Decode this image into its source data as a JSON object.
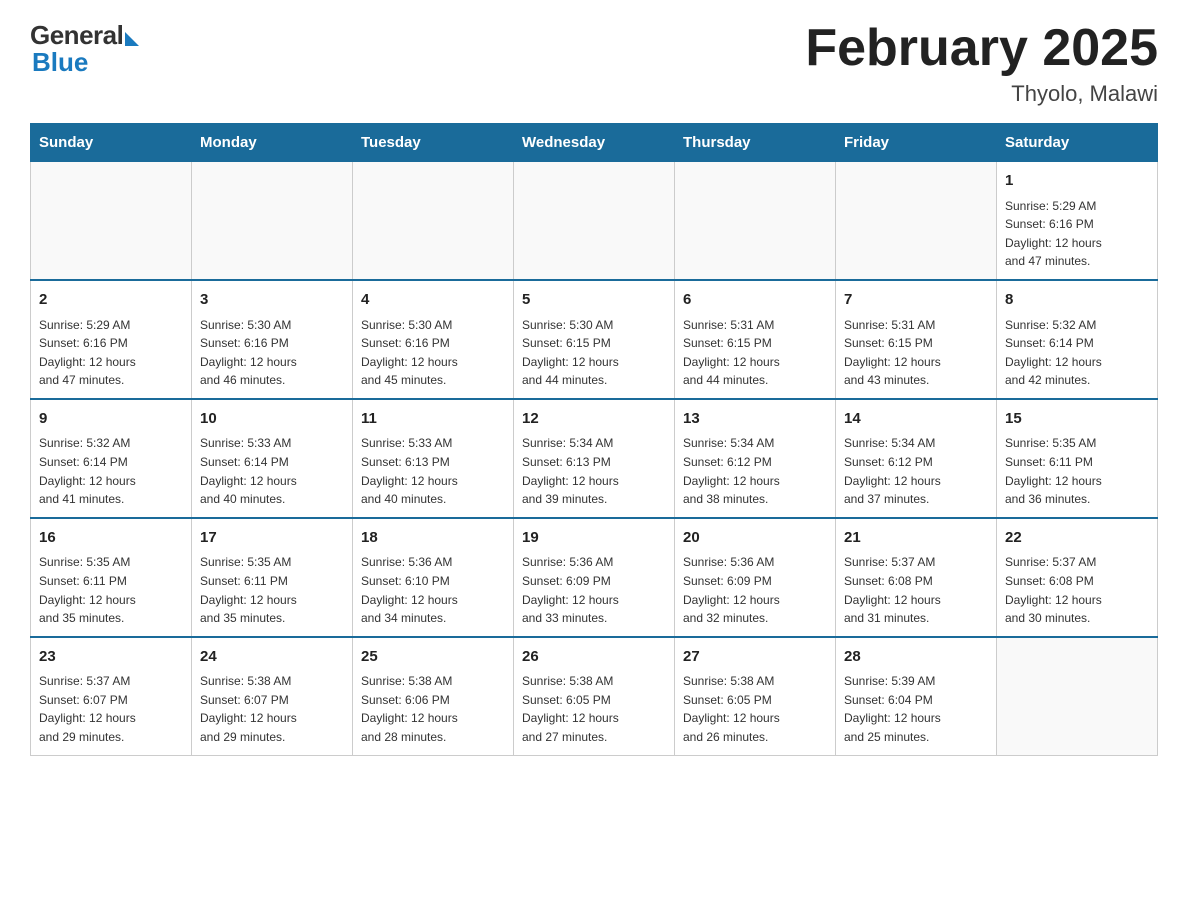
{
  "header": {
    "logo_general": "General",
    "logo_blue": "Blue",
    "month_title": "February 2025",
    "location": "Thyolo, Malawi"
  },
  "days_of_week": [
    "Sunday",
    "Monday",
    "Tuesday",
    "Wednesday",
    "Thursday",
    "Friday",
    "Saturday"
  ],
  "weeks": [
    [
      {
        "day": "",
        "info": ""
      },
      {
        "day": "",
        "info": ""
      },
      {
        "day": "",
        "info": ""
      },
      {
        "day": "",
        "info": ""
      },
      {
        "day": "",
        "info": ""
      },
      {
        "day": "",
        "info": ""
      },
      {
        "day": "1",
        "info": "Sunrise: 5:29 AM\nSunset: 6:16 PM\nDaylight: 12 hours\nand 47 minutes."
      }
    ],
    [
      {
        "day": "2",
        "info": "Sunrise: 5:29 AM\nSunset: 6:16 PM\nDaylight: 12 hours\nand 47 minutes."
      },
      {
        "day": "3",
        "info": "Sunrise: 5:30 AM\nSunset: 6:16 PM\nDaylight: 12 hours\nand 46 minutes."
      },
      {
        "day": "4",
        "info": "Sunrise: 5:30 AM\nSunset: 6:16 PM\nDaylight: 12 hours\nand 45 minutes."
      },
      {
        "day": "5",
        "info": "Sunrise: 5:30 AM\nSunset: 6:15 PM\nDaylight: 12 hours\nand 44 minutes."
      },
      {
        "day": "6",
        "info": "Sunrise: 5:31 AM\nSunset: 6:15 PM\nDaylight: 12 hours\nand 44 minutes."
      },
      {
        "day": "7",
        "info": "Sunrise: 5:31 AM\nSunset: 6:15 PM\nDaylight: 12 hours\nand 43 minutes."
      },
      {
        "day": "8",
        "info": "Sunrise: 5:32 AM\nSunset: 6:14 PM\nDaylight: 12 hours\nand 42 minutes."
      }
    ],
    [
      {
        "day": "9",
        "info": "Sunrise: 5:32 AM\nSunset: 6:14 PM\nDaylight: 12 hours\nand 41 minutes."
      },
      {
        "day": "10",
        "info": "Sunrise: 5:33 AM\nSunset: 6:14 PM\nDaylight: 12 hours\nand 40 minutes."
      },
      {
        "day": "11",
        "info": "Sunrise: 5:33 AM\nSunset: 6:13 PM\nDaylight: 12 hours\nand 40 minutes."
      },
      {
        "day": "12",
        "info": "Sunrise: 5:34 AM\nSunset: 6:13 PM\nDaylight: 12 hours\nand 39 minutes."
      },
      {
        "day": "13",
        "info": "Sunrise: 5:34 AM\nSunset: 6:12 PM\nDaylight: 12 hours\nand 38 minutes."
      },
      {
        "day": "14",
        "info": "Sunrise: 5:34 AM\nSunset: 6:12 PM\nDaylight: 12 hours\nand 37 minutes."
      },
      {
        "day": "15",
        "info": "Sunrise: 5:35 AM\nSunset: 6:11 PM\nDaylight: 12 hours\nand 36 minutes."
      }
    ],
    [
      {
        "day": "16",
        "info": "Sunrise: 5:35 AM\nSunset: 6:11 PM\nDaylight: 12 hours\nand 35 minutes."
      },
      {
        "day": "17",
        "info": "Sunrise: 5:35 AM\nSunset: 6:11 PM\nDaylight: 12 hours\nand 35 minutes."
      },
      {
        "day": "18",
        "info": "Sunrise: 5:36 AM\nSunset: 6:10 PM\nDaylight: 12 hours\nand 34 minutes."
      },
      {
        "day": "19",
        "info": "Sunrise: 5:36 AM\nSunset: 6:09 PM\nDaylight: 12 hours\nand 33 minutes."
      },
      {
        "day": "20",
        "info": "Sunrise: 5:36 AM\nSunset: 6:09 PM\nDaylight: 12 hours\nand 32 minutes."
      },
      {
        "day": "21",
        "info": "Sunrise: 5:37 AM\nSunset: 6:08 PM\nDaylight: 12 hours\nand 31 minutes."
      },
      {
        "day": "22",
        "info": "Sunrise: 5:37 AM\nSunset: 6:08 PM\nDaylight: 12 hours\nand 30 minutes."
      }
    ],
    [
      {
        "day": "23",
        "info": "Sunrise: 5:37 AM\nSunset: 6:07 PM\nDaylight: 12 hours\nand 29 minutes."
      },
      {
        "day": "24",
        "info": "Sunrise: 5:38 AM\nSunset: 6:07 PM\nDaylight: 12 hours\nand 29 minutes."
      },
      {
        "day": "25",
        "info": "Sunrise: 5:38 AM\nSunset: 6:06 PM\nDaylight: 12 hours\nand 28 minutes."
      },
      {
        "day": "26",
        "info": "Sunrise: 5:38 AM\nSunset: 6:05 PM\nDaylight: 12 hours\nand 27 minutes."
      },
      {
        "day": "27",
        "info": "Sunrise: 5:38 AM\nSunset: 6:05 PM\nDaylight: 12 hours\nand 26 minutes."
      },
      {
        "day": "28",
        "info": "Sunrise: 5:39 AM\nSunset: 6:04 PM\nDaylight: 12 hours\nand 25 minutes."
      },
      {
        "day": "",
        "info": ""
      }
    ]
  ]
}
